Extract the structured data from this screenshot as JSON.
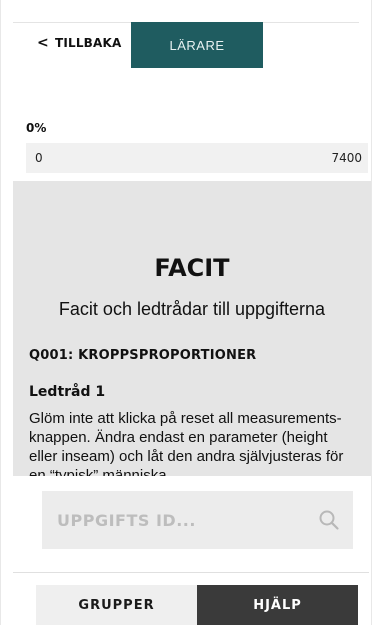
{
  "header": {
    "back_label": "TILLBAKA",
    "teacher_tab_label": "LÄRARE"
  },
  "progress": {
    "percent_label": "0%",
    "percent_value": 0,
    "range_min": "0",
    "range_max": "7400"
  },
  "facit": {
    "title": "FACIT",
    "subtitle": "Facit och ledtrådar till uppgifterna",
    "question_title": "Q001: KROPPSPROPORTIONER",
    "hint_title": "Ledtråd 1",
    "hint_text": "Glöm inte att klicka på reset all measurements-knappen. Ändra endast en parameter (height eller inseam) och låt den andra självjusteras för en “typisk” människa"
  },
  "search": {
    "placeholder": "UPPGIFTS ID...",
    "value": "",
    "icon": "search-icon"
  },
  "bottom_nav": {
    "groups_label": "GRUPPER",
    "help_label": "HJÄLP"
  },
  "colors": {
    "accent_teal": "#1f5c60",
    "help_dark": "#3a3a3a",
    "panel_gray": "#e5e5e5"
  }
}
